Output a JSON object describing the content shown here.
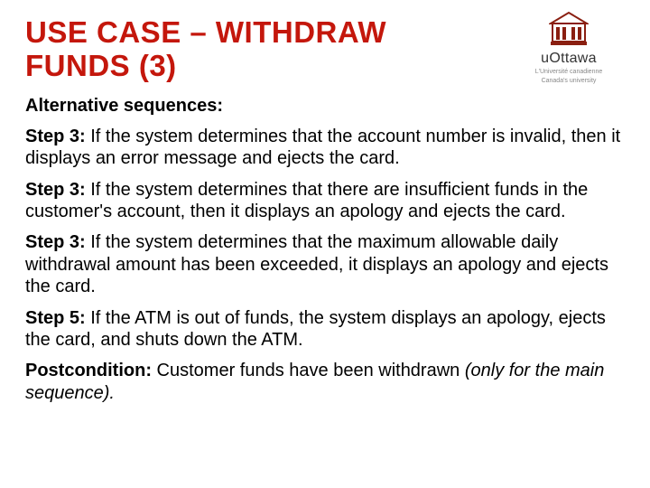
{
  "title": "USE CASE – WITHDRAW FUNDS (3)",
  "subtitle": "Alternative sequences:",
  "steps": [
    {
      "label": "Step 3:",
      "text": " If the system determines that the account number is invalid, then it displays an error message and ejects the card."
    },
    {
      "label": "Step 3:",
      "text": " If the system determines that there are insufficient funds in the customer's account, then it displays an apology and ejects the card."
    },
    {
      "label": "Step 3:",
      "text": " If the system determines that the maximum allowable daily withdrawal amount has been exceeded, it displays an apology and ejects the card."
    },
    {
      "label": "Step 5:",
      "text": " If the ATM is out of funds, the system displays an apology, ejects the card, and shuts down the ATM."
    },
    {
      "label": "Postcondition:",
      "text": " Customer funds have been withdrawn ",
      "italic": "(only for the main sequence)."
    }
  ],
  "logo": {
    "name": "uOttawa",
    "sub1": "L'Université canadienne",
    "sub2": "Canada's university"
  }
}
